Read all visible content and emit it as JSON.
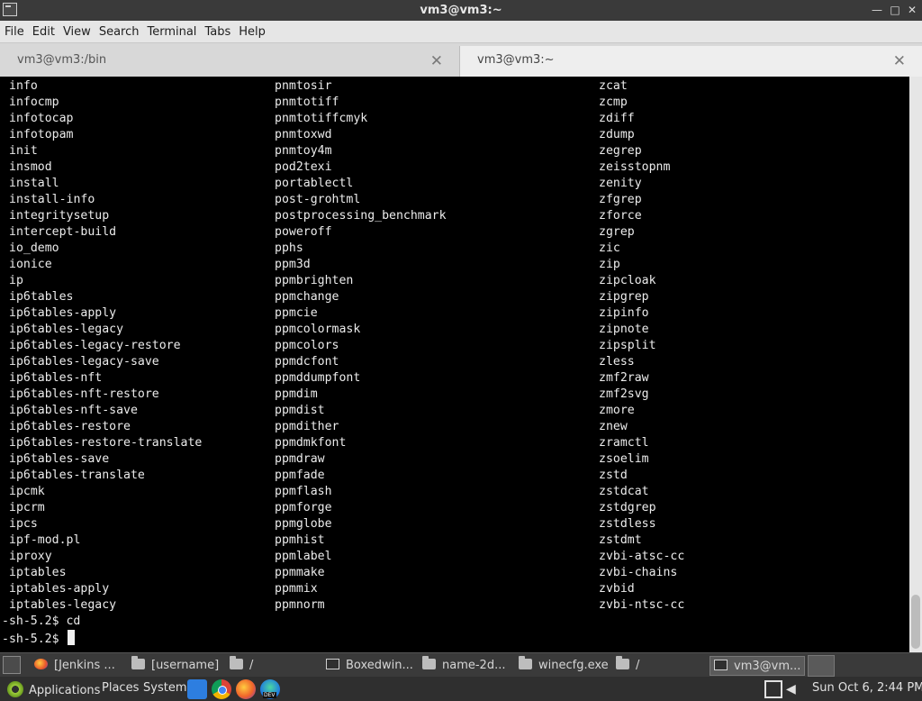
{
  "window": {
    "title": "vm3@vm3:~"
  },
  "menubar": {
    "items": [
      "File",
      "Edit",
      "View",
      "Search",
      "Terminal",
      "Tabs",
      "Help"
    ]
  },
  "tabs": [
    {
      "label": "vm3@vm3:/bin"
    },
    {
      "label": "vm3@vm3:~"
    }
  ],
  "terminal": {
    "columns": [
      [
        "info",
        "infocmp",
        "infotocap",
        "infotopam",
        "init",
        "insmod",
        "install",
        "install-info",
        "integritysetup",
        "intercept-build",
        "io_demo",
        "ionice",
        "ip",
        "ip6tables",
        "ip6tables-apply",
        "ip6tables-legacy",
        "ip6tables-legacy-restore",
        "ip6tables-legacy-save",
        "ip6tables-nft",
        "ip6tables-nft-restore",
        "ip6tables-nft-save",
        "ip6tables-restore",
        "ip6tables-restore-translate",
        "ip6tables-save",
        "ip6tables-translate",
        "ipcmk",
        "ipcrm",
        "ipcs",
        "ipf-mod.pl",
        "iproxy",
        "iptables",
        "iptables-apply",
        "iptables-legacy"
      ],
      [
        "pnmtosir",
        "pnmtotiff",
        "pnmtotiffcmyk",
        "pnmtoxwd",
        "pnmtoy4m",
        "pod2texi",
        "portablectl",
        "post-grohtml",
        "postprocessing_benchmark",
        "poweroff",
        "pphs",
        "ppm3d",
        "ppmbrighten",
        "ppmchange",
        "ppmcie",
        "ppmcolormask",
        "ppmcolors",
        "ppmdcfont",
        "ppmddumpfont",
        "ppmdim",
        "ppmdist",
        "ppmdither",
        "ppmdmkfont",
        "ppmdraw",
        "ppmfade",
        "ppmflash",
        "ppmforge",
        "ppmglobe",
        "ppmhist",
        "ppmlabel",
        "ppmmake",
        "ppmmix",
        "ppmnorm"
      ],
      [
        "zcat",
        "zcmp",
        "zdiff",
        "zdump",
        "zegrep",
        "zeisstopnm",
        "zenity",
        "zfgrep",
        "zforce",
        "zgrep",
        "zic",
        "zip",
        "zipcloak",
        "zipgrep",
        "zipinfo",
        "zipnote",
        "zipsplit",
        "zless",
        "zmf2raw",
        "zmf2svg",
        "zmore",
        "znew",
        "zramctl",
        "zsoelim",
        "zstd",
        "zstdcat",
        "zstdgrep",
        "zstdless",
        "zstdmt",
        "zvbi-atsc-cc",
        "zvbi-chains",
        "zvbid",
        "zvbi-ntsc-cc"
      ]
    ],
    "prompt_lines": [
      "-sh-5.2$ cd",
      "-sh-5.2$ "
    ]
  },
  "window_list": {
    "items": [
      {
        "label": "[Jenkins ...",
        "icon": "firefox-icon"
      },
      {
        "label": "[username]",
        "icon": "folder-icon"
      },
      {
        "label": "/",
        "icon": "folder-icon"
      },
      {
        "label": "Boxedwin...",
        "icon": "terminal-icon"
      },
      {
        "label": "name-2d...",
        "icon": "folder-icon"
      },
      {
        "label": "winecfg.exe",
        "icon": "folder-icon"
      },
      {
        "label": "/",
        "icon": "folder-icon"
      },
      {
        "label": "vm3@vm...",
        "icon": "terminal-icon"
      }
    ]
  },
  "panel": {
    "applications": "Applications",
    "places": "Places",
    "system": "System",
    "clock": "Sun Oct  6,  2:44 PM"
  }
}
